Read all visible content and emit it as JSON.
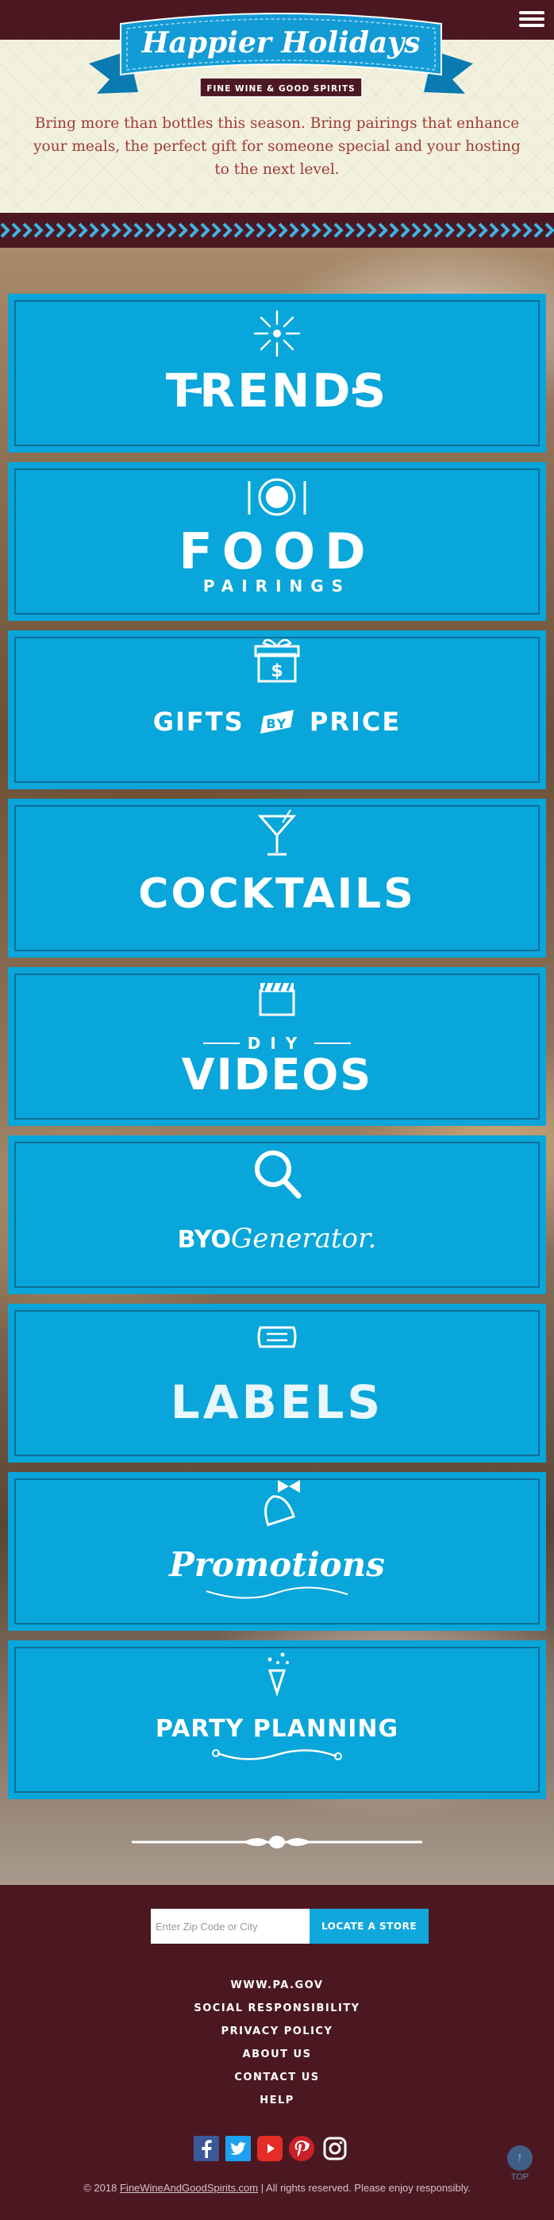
{
  "header": {
    "logo_title": "Happier Holidays",
    "logo_subtitle": "FINE WINE & GOOD SPIRITS",
    "tagline": "Bring more than bottles this season. Bring pairings that enhance your meals, the perfect gift for someone special and your hosting to the next level.",
    "menu_icon": "hamburger-icon"
  },
  "tiles": [
    {
      "label": "TRENDS",
      "icon": "sparkle-icon"
    },
    {
      "label_main": "FOOD",
      "label_sub": "PAIRINGS",
      "icon": "plate-utensils-icon"
    },
    {
      "label_left": "GIFTS",
      "label_mid": "BY",
      "label_right": "PRICE",
      "icon": "gift-dollar-icon"
    },
    {
      "label": "COCKTAILS",
      "icon": "martini-glass-icon"
    },
    {
      "label_top": "DIY",
      "label_main": "VIDEOS",
      "icon": "clapperboard-icon"
    },
    {
      "label_left": "BYO",
      "label_right": "Generator.",
      "icon": "magnifier-icon"
    },
    {
      "label": "LABELS",
      "icon": "label-tag-icon"
    },
    {
      "label": "Promotions",
      "icon": "bell-bow-icon"
    },
    {
      "label": "PARTY PLANNING",
      "icon": "party-popper-icon"
    }
  ],
  "footer": {
    "zip_placeholder": "Enter Zip Code or City",
    "locate_label": "LOCATE A STORE",
    "links": [
      "WWW.PA.GOV",
      "SOCIAL RESPONSIBILITY",
      "PRIVACY POLICY",
      "ABOUT US",
      "CONTACT US",
      "HELP"
    ],
    "social_icons": [
      "facebook-icon",
      "twitter-icon",
      "youtube-icon",
      "pinterest-icon",
      "instagram-icon"
    ],
    "copyright_prefix": "© 2018",
    "copyright_link": "FineWineAndGoodSpirits.com",
    "copyright_suffix": "| All rights reserved. Please enjoy responsibly.",
    "top_label": "TOP"
  },
  "colors": {
    "tile_blue": "#08a6da",
    "maroon": "#4b1822",
    "tagline_red": "#a13a35",
    "header_cream": "#f2f1de"
  }
}
